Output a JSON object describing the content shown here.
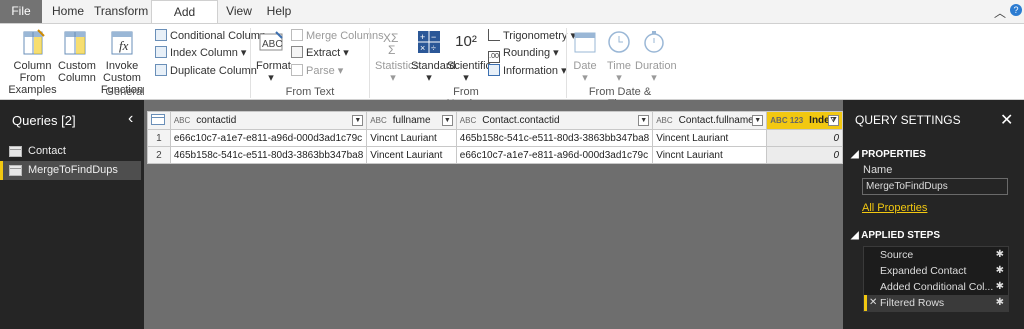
{
  "tabs": [
    "File",
    "Home",
    "Transform",
    "Add Column",
    "View",
    "Help"
  ],
  "active_tab": "Add Column",
  "ribbon": {
    "general": {
      "column_from_examples": [
        "Column From",
        "Examples"
      ],
      "custom_column": [
        "Custom",
        "Column"
      ],
      "invoke_custom_function": [
        "Invoke Custom",
        "Function"
      ],
      "conditional_column": "Conditional Column",
      "index_column": "Index Column",
      "duplicate_column": "Duplicate Column",
      "label": "General"
    },
    "from_text": {
      "format": "Format",
      "merge_columns": "Merge Columns",
      "extract": "Extract",
      "parse": "Parse",
      "label": "From Text"
    },
    "from_number": {
      "statistics": "Statistics",
      "standard": "Standard",
      "scientific": "Scientific",
      "scientific_glyph": "10²",
      "trigonometry": "Trigonometry",
      "rounding": "Rounding",
      "information": "Information",
      "label": "From Number"
    },
    "from_date_time": {
      "date": "Date",
      "time": "Time",
      "duration": "Duration",
      "label": "From Date & Time"
    }
  },
  "queries": {
    "title": "Queries [2]",
    "items": [
      "Contact",
      "MergeToFindDups"
    ],
    "selected": "MergeToFindDups"
  },
  "table": {
    "columns": [
      {
        "type": "ABC",
        "name": "contactid"
      },
      {
        "type": "ABC",
        "name": "fullname"
      },
      {
        "type": "ABC",
        "name": "Contact.contactid"
      },
      {
        "type": "ABC",
        "name": "Contact.fullname"
      },
      {
        "type": "ABC 123",
        "name": "Index"
      }
    ],
    "rows": [
      {
        "num": "1",
        "cells": [
          "e66c10c7-a1e7-e811-a96d-000d3ad1c79c",
          "Vincnt Lauriant",
          "465b158c-541c-e511-80d3-3863bb347ba8",
          "Vincent Lauriant",
          "0"
        ]
      },
      {
        "num": "2",
        "cells": [
          "465b158c-541c-e511-80d3-3863bb347ba8",
          "Vincent Lauriant",
          "e66c10c7-a1e7-e811-a96d-000d3ad1c79c",
          "Vincnt Lauriant",
          "0"
        ]
      }
    ]
  },
  "settings": {
    "title": "QUERY SETTINGS",
    "properties_header": "PROPERTIES",
    "name_label": "Name",
    "name_value": "MergeToFindDups",
    "all_properties": "All Properties",
    "applied_steps_header": "APPLIED STEPS",
    "steps": [
      "Source",
      "Expanded Contact",
      "Added Conditional Col...",
      "Filtered Rows"
    ],
    "selected_step": "Filtered Rows"
  },
  "colors": {
    "accent": "#f2c811",
    "dark_panel": "#252525",
    "grid_bg": "#6e6e6e"
  }
}
